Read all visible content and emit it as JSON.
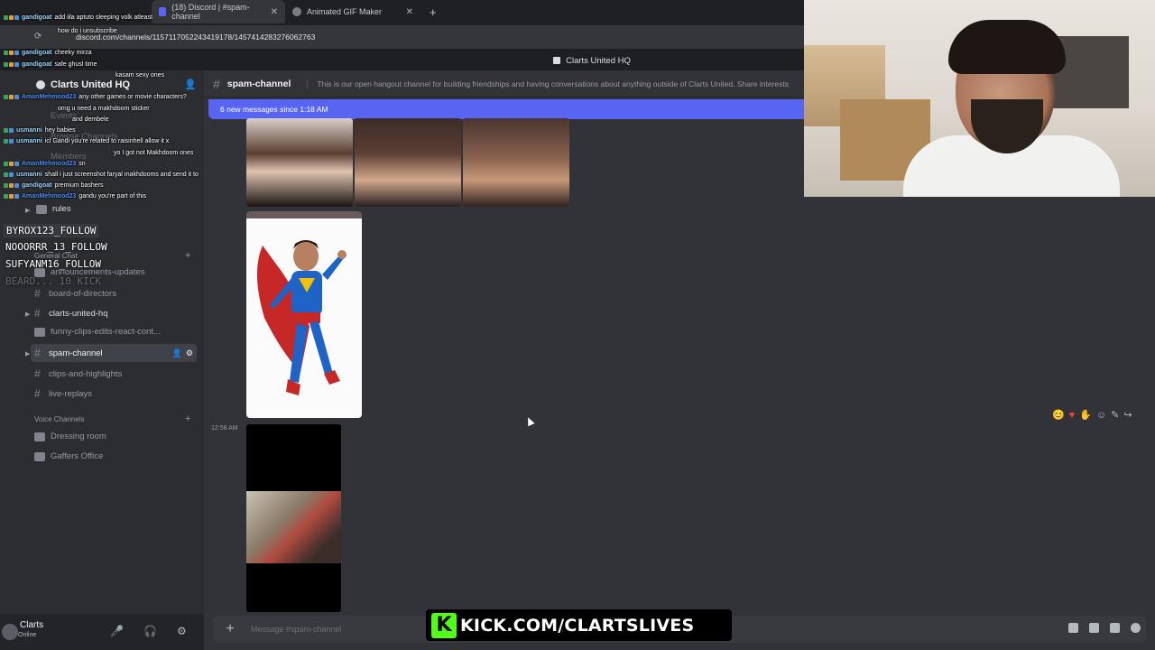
{
  "browser": {
    "tabs": [
      {
        "label": "(18) Discord | #spam-channel",
        "active": true
      },
      {
        "label": "Animated GIF Maker",
        "active": false
      }
    ],
    "url": "discord.com/channels/1157117052243419178/1457414283276062763"
  },
  "server": {
    "title": "Clarts United HQ",
    "name": "Clarts United HQ"
  },
  "sidebar": {
    "rules_label": "rules",
    "general_chat": "General Chat",
    "channels": [
      {
        "label": "announcements-updates"
      },
      {
        "label": "board-of-directors"
      },
      {
        "label": "clarts-united-hq"
      },
      {
        "label": "funny-clips-edits-react-cont..."
      },
      {
        "label": "spam-channel"
      },
      {
        "label": "clips-and-highlights"
      },
      {
        "label": "live-replays"
      }
    ],
    "voice_category": "Voice Channels",
    "voice_channels": [
      {
        "label": "Dressing room"
      },
      {
        "label": "Gaffers Office"
      }
    ],
    "hidden_items": [
      "Events",
      "Browse Channels",
      "Members"
    ]
  },
  "user": {
    "name": "Clarts",
    "status": "Online"
  },
  "channel": {
    "name": "spam-channel",
    "topic": "This is our open hangout channel for building friendships and having conversations about anything outside of Clarts United. Share interests",
    "new_messages_banner": "6 new messages since 1:18 AM",
    "timestamp": "12:58 AM",
    "composer_placeholder": "Message #spam-channel"
  },
  "stream_chat": [
    {
      "user": "gandigoat",
      "text": "add iila aptuto sleeping volk atleast"
    },
    {
      "user": "",
      "text": "how do i unsubscribe"
    },
    {
      "user": "gandigoat",
      "text": "cheeky mirza"
    },
    {
      "user": "gandigoat",
      "text": "safe ghusl time"
    },
    {
      "user": "",
      "text": "kasam sexy ones"
    },
    {
      "user": "AmanMehmood23",
      "text": "any other games or movie characters?"
    },
    {
      "user": "",
      "text": "omg u need a makhdoom sticker"
    },
    {
      "user": "",
      "text": "and dembele"
    },
    {
      "user": "usmanni",
      "text": "hey babies"
    },
    {
      "user": "usmanni",
      "text": "icl Gandi you're related to raisinhell allow it x"
    },
    {
      "user": "",
      "text": "yo I got not Makhdoom ones"
    },
    {
      "user": "AmanMehmood23",
      "text": "sn"
    },
    {
      "user": "usmanni",
      "text": "shall i just screenshot faryal makhdooms and send it to"
    },
    {
      "user": "gandigoat",
      "text": "premium bashers"
    },
    {
      "user": "AmanMehmood23",
      "text": "gandu you're part of this"
    }
  ],
  "follows": [
    {
      "text": "BYROX123_FOLLOW"
    },
    {
      "text": "NOOORRR_13_FOLLOW"
    },
    {
      "text": "SUFYANM16_FOLLOW"
    },
    {
      "text": "BEARD... 10 KICK"
    }
  ],
  "overlay": {
    "kick_letter": "K",
    "kick_url": "KICK.COM/CLARTSLIVES"
  },
  "colors": {
    "accent": "#5865f2",
    "kick_green": "#53fc18",
    "muted_red": "#f23f42"
  }
}
